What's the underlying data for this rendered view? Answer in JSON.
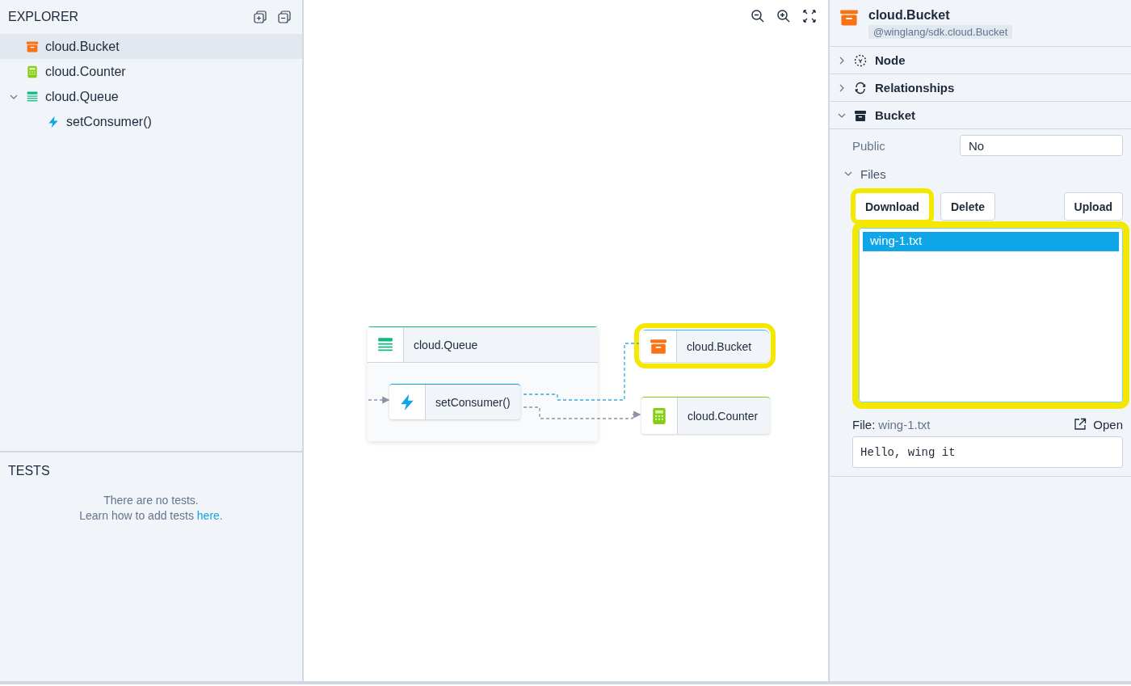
{
  "explorer": {
    "title": "EXPLORER",
    "items": [
      {
        "kind": "bucket",
        "label": "cloud.Bucket",
        "selected": true
      },
      {
        "kind": "counter",
        "label": "cloud.Counter",
        "selected": false
      },
      {
        "kind": "queue",
        "label": "cloud.Queue",
        "selected": false,
        "expanded": true,
        "children": [
          {
            "kind": "function",
            "label": "setConsumer()",
            "selected": false
          }
        ]
      }
    ]
  },
  "tests": {
    "title": "TESTS",
    "empty_message": "There are no tests.",
    "hint": "Learn how to add tests",
    "link": "here."
  },
  "diagram": {
    "nodes": [
      {
        "kind": "queue",
        "label": "cloud.Queue",
        "highlighted": false,
        "children": [
          {
            "kind": "function",
            "label": "setConsumer()",
            "highlighted": false
          }
        ]
      },
      {
        "kind": "bucket",
        "label": "cloud.Bucket",
        "highlighted": true
      },
      {
        "kind": "counter",
        "label": "cloud.Counter",
        "highlighted": false
      }
    ]
  },
  "inspector": {
    "title": "cloud.Bucket",
    "kind": "bucket",
    "type_tag": "@winglang/sdk.cloud.Bucket",
    "sections": [
      {
        "kind": "node",
        "label": "Node",
        "expanded": false
      },
      {
        "kind": "relationships",
        "label": "Relationships",
        "expanded": false
      },
      {
        "kind": "bucket",
        "label": "Bucket",
        "expanded": true
      }
    ],
    "fields": [
      {
        "label": "Public",
        "value": "No"
      }
    ],
    "files": {
      "label": "Files",
      "expanded": true,
      "buttons": [
        {
          "label": "Download",
          "highlighted": true
        },
        {
          "label": "Delete",
          "highlighted": false
        },
        {
          "label": "Upload",
          "highlighted": false
        }
      ],
      "list_highlighted": true,
      "items": [
        {
          "name": "wing-1.txt",
          "selected": true
        }
      ],
      "preview_label": "File:",
      "preview_name": "wing-1.txt",
      "open_label": "Open",
      "content": "Hello, wing it"
    }
  }
}
